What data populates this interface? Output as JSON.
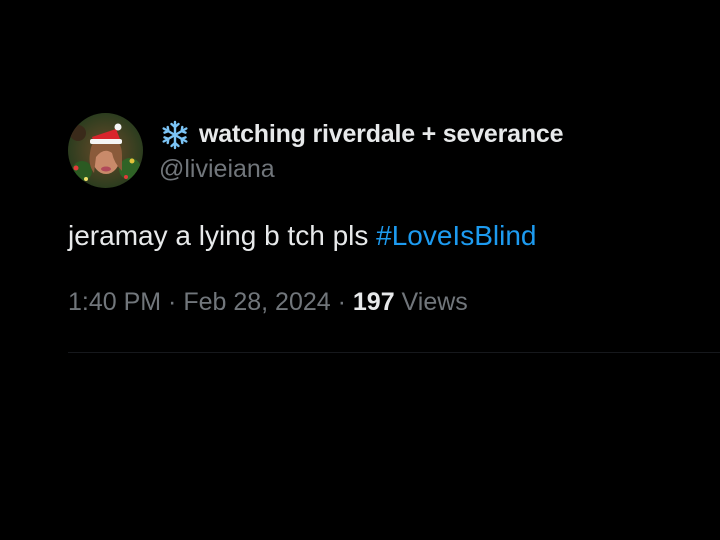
{
  "user": {
    "display_name": "watching riverdale + severance",
    "handle": "@livieiana",
    "name_emoji_icon": "snowflake-icon",
    "avatar_icon": "avatar"
  },
  "tweet": {
    "text": "jeramay a lying b tch pls ",
    "hashtag": "#LoveIsBlind"
  },
  "meta": {
    "time": "1:40 PM",
    "separator1": " · ",
    "date": "Feb 28, 2024",
    "separator2": " · ",
    "views_count": "197",
    "views_label": " Views"
  },
  "colors": {
    "background": "#000000",
    "text": "#e7e9ea",
    "secondary": "#71767b",
    "link": "#1d9bf0",
    "snowflake": "#7cc4f5"
  }
}
